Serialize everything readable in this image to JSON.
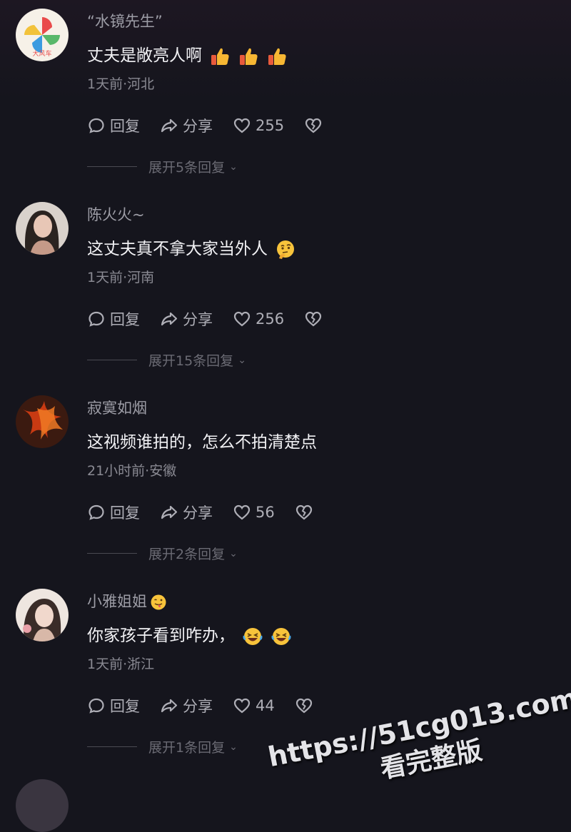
{
  "labels": {
    "reply": "回复",
    "share": "分享"
  },
  "comments": [
    {
      "username": "“水镜先生”",
      "text": "丈夫是敞亮人啊",
      "meta": "1天前·河北",
      "likes": "255",
      "expand": "展开5条回复",
      "emoji": "thumbs-up",
      "emoji_count": 3,
      "avatar_colors": [
        "#f6f1e8",
        "#e94b4b",
        "#f2c23a",
        "#3b9be0",
        "#58b86a"
      ]
    },
    {
      "username": "陈火火~",
      "text": "这丈夫真不拿大家当外人",
      "meta": "1天前·河南",
      "likes": "256",
      "expand": "展开15条回复",
      "emoji": "thinking-face",
      "emoji_count": 1,
      "avatar_colors": [
        "#d9d2cc",
        "#2a2320",
        "#c59a88"
      ]
    },
    {
      "username": "寂寞如烟",
      "text": "这视频谁拍的，怎么不拍清楚点",
      "meta": "21小时前·安徽",
      "likes": "56",
      "expand": "展开2条回复",
      "emoji": "",
      "emoji_count": 0,
      "avatar_colors": [
        "#c83a12",
        "#f07a25",
        "#3b1a10"
      ]
    },
    {
      "username": "小雅姐姐",
      "text": "你家孩子看到咋办，",
      "meta": "1天前·浙江",
      "likes": "44",
      "expand": "展开1条回复",
      "emoji": "rolling-laughing-face",
      "emoji_count": 2,
      "username_emoji": "tongue-face",
      "avatar_colors": [
        "#eee6e0",
        "#3a2c28",
        "#d8b8a8"
      ]
    }
  ],
  "watermark": {
    "url": "https://51cg013.com",
    "caption": "看完整版"
  }
}
